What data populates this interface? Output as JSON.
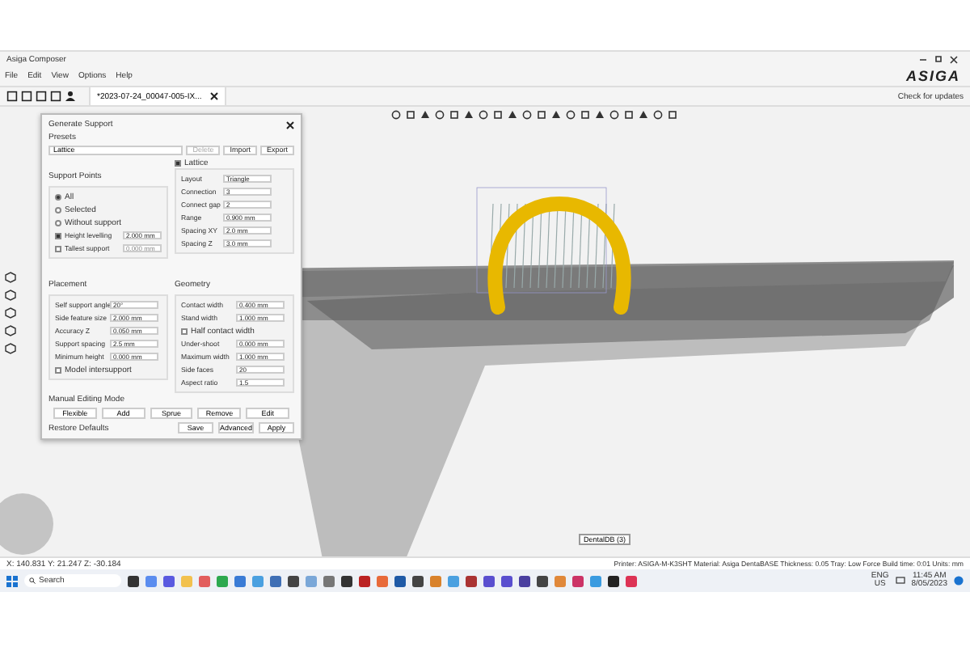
{
  "window": {
    "title": "Asiga Composer",
    "brand": "ASIGA",
    "update_link": "Check for updates"
  },
  "menu": [
    "File",
    "Edit",
    "View",
    "Options",
    "Help"
  ],
  "tabs": [
    {
      "label": "*2023-07-24_00047-005-IX...",
      "selected": true
    }
  ],
  "dialog": {
    "title": "Generate Support",
    "presets_label": "Presets",
    "preset": "Lattice",
    "preset_buttons": [
      {
        "label": "Delete",
        "disabled": true
      },
      {
        "label": "Import",
        "disabled": false
      },
      {
        "label": "Export",
        "disabled": false
      }
    ],
    "support_points": {
      "title": "Support Points",
      "options": [
        {
          "label": "All",
          "selected": true
        },
        {
          "label": "Selected",
          "selected": false
        },
        {
          "label": "Without support",
          "selected": false
        }
      ],
      "checks": [
        {
          "label": "Height levelling",
          "checked": true,
          "value": "2.000 mm"
        },
        {
          "label": "Tallest support",
          "checked": false,
          "value": "0.000 mm"
        }
      ]
    },
    "lattice": {
      "title": "Lattice",
      "checked": true,
      "fields": [
        {
          "label": "Layout",
          "value": "Triangle"
        },
        {
          "label": "Connection",
          "value": "3"
        },
        {
          "label": "Connect gap",
          "value": "2"
        },
        {
          "label": "Range",
          "value": "0.900 mm"
        },
        {
          "label": "Spacing XY",
          "value": "2.0 mm"
        },
        {
          "label": "Spacing Z",
          "value": "3.0 mm"
        }
      ]
    },
    "placement": {
      "title": "Placement",
      "rows": [
        {
          "kind": "field",
          "label": "Self support angle",
          "value": "20°"
        },
        {
          "kind": "field",
          "label": "Side feature size",
          "value": "2.000 mm"
        },
        {
          "kind": "field",
          "label": "Accuracy Z",
          "value": "0.050 mm"
        },
        {
          "kind": "field",
          "label": "Support spacing",
          "value": "2.5 mm"
        },
        {
          "kind": "field",
          "label": "Minimum height",
          "value": "0.000 mm"
        },
        {
          "kind": "check",
          "label": "Model intersupport",
          "checked": false
        }
      ]
    },
    "geometry": {
      "title": "Geometry",
      "rows": [
        {
          "kind": "field",
          "label": "Contact width",
          "value": "0.400 mm"
        },
        {
          "kind": "field",
          "label": "Stand width",
          "value": "1.000 mm"
        },
        {
          "kind": "check",
          "label": "Half contact width",
          "checked": false
        },
        {
          "kind": "field",
          "label": "Under-shoot",
          "value": "0.000 mm"
        },
        {
          "kind": "field",
          "label": "Maximum width",
          "value": "1.000 mm"
        },
        {
          "kind": "field",
          "label": "Side faces",
          "value": "20"
        },
        {
          "kind": "field",
          "label": "Aspect ratio",
          "value": "1.5"
        }
      ]
    },
    "manual": {
      "title": "Manual Editing Mode",
      "buttons": [
        "Flexible",
        "Add",
        "Sprue",
        "Remove",
        "Edit"
      ]
    },
    "footer": {
      "restore": "Restore Defaults",
      "buttons": [
        "Save",
        "Advanced",
        "Apply"
      ]
    }
  },
  "viewport": {
    "tooltip": "DentalDB (3)"
  },
  "status_bar": {
    "coords": "X: 140.831  Y: 21.247  Z: -30.184",
    "info": "Printer: ASIGA-M-K3SHT  Material: Asiga DentaBASE  Thickness: 0.05  Tray: Low Force  Build time: 0:01  Units: mm"
  },
  "taskbar": {
    "search": "Search",
    "lang": "ENG",
    "region": "US",
    "time": "11:45 AM",
    "date": "8/05/2023"
  }
}
